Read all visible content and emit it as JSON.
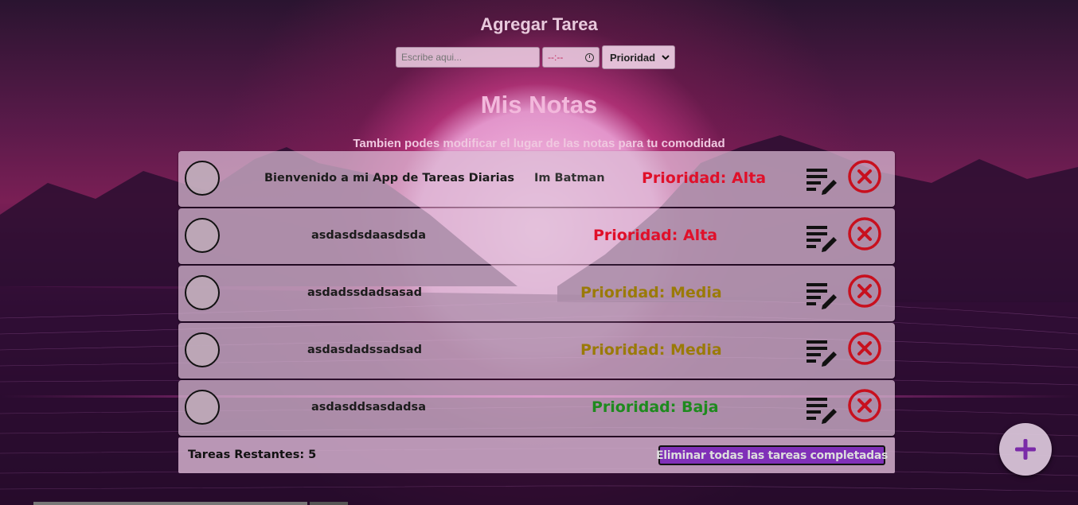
{
  "form": {
    "title": "Agregar Tarea",
    "task_placeholder": "Escribe aqui...",
    "time_placeholder": "--:--",
    "priority_selected": "Prioridad"
  },
  "notes_section": {
    "title": "Mis Notas",
    "subtitle": "Tambien podes modificar el lugar de las notas para tu comodidad"
  },
  "notes": [
    {
      "text": "Bienvenido a mi App de Tareas Diarias",
      "author": "Im Batman",
      "priority": "Prioridad: Alta",
      "priority_color": "#e0102a"
    },
    {
      "text": "asdasdsdaasdsda",
      "author": "",
      "priority": "Prioridad: Alta",
      "priority_color": "#e0102a"
    },
    {
      "text": "asdadssdadsasad",
      "author": "",
      "priority": "Prioridad: Media",
      "priority_color": "#9a7a08"
    },
    {
      "text": "asdasdadssadsad",
      "author": "",
      "priority": "Prioridad: Media",
      "priority_color": "#9a7a08"
    },
    {
      "text": "asdasddsasdadsa",
      "author": "",
      "priority": "Prioridad: Baja",
      "priority_color": "#1e8a1e"
    }
  ],
  "footer": {
    "remaining": "Tareas Restantes: 5",
    "clear_button": "Eliminar todas las tareas completadas"
  },
  "icons": {
    "edit": "edit-list-icon",
    "delete": "close-circle-icon",
    "add": "plus-icon",
    "clock": "clock-icon",
    "chevron": "chevron-down-icon"
  },
  "colors": {
    "delete_icon": "#c8101e",
    "fab_plus": "#7a2aa8",
    "clear_button_bg": "#8030b8"
  }
}
